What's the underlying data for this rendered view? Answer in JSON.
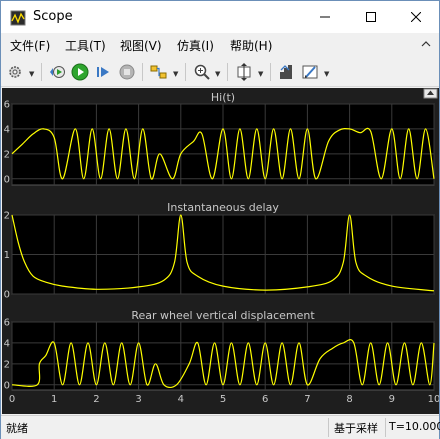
{
  "window": {
    "title": "Scope"
  },
  "menu": [
    "文件(F)",
    "工具(T)",
    "视图(V)",
    "仿真(I)",
    "帮助(H)"
  ],
  "toolbar": {
    "icons": [
      "gear-icon",
      "restore-settings-icon",
      "run-icon",
      "step-forward-icon",
      "stop-icon",
      "highlight-icon",
      "zoom-in-icon",
      "scale-axes-icon",
      "cursor-measure-icon",
      "style-icon"
    ]
  },
  "plots": [
    {
      "title": "Hi(t)",
      "yticks": [
        "0",
        "2",
        "4",
        "6"
      ]
    },
    {
      "title": "Instantaneous delay",
      "yticks": [
        "0",
        "1",
        "2"
      ]
    },
    {
      "title": "Rear wheel vertical displacement",
      "yticks": [
        "0",
        "2",
        "4",
        "6"
      ]
    }
  ],
  "xticks": [
    "0",
    "1",
    "2",
    "3",
    "4",
    "5",
    "6",
    "7",
    "8",
    "9",
    "10"
  ],
  "status": {
    "left": "就绪",
    "sample": "基于采样",
    "time": "T=10.000"
  },
  "colors": {
    "trace": "#ffff00",
    "axes_bg": "#000000",
    "figure_bg": "#1e1e1e",
    "grid": "#3a3a3a",
    "text": "#c8c8c8"
  },
  "chart_data": [
    {
      "type": "line",
      "title": "Hi(t)",
      "xlim": [
        0,
        10
      ],
      "ylim": [
        -0.5,
        6
      ],
      "grid": true,
      "x": [
        0,
        0.25,
        0.5,
        0.75,
        1.0,
        1.2,
        1.5,
        1.7,
        1.9,
        2.1,
        2.3,
        2.5,
        2.7,
        2.9,
        3.1,
        3.3,
        3.5,
        3.8,
        4.0,
        4.3,
        4.5,
        4.75,
        5.0,
        5.2,
        5.4,
        5.6,
        5.8,
        6.0,
        6.2,
        6.4,
        6.6,
        6.8,
        7.0,
        7.2,
        7.5,
        7.75,
        8.0,
        8.25,
        8.5,
        8.75,
        9.0,
        9.2,
        9.4,
        9.6,
        9.8,
        10.0
      ],
      "y": [
        2.0,
        2.8,
        3.6,
        4.0,
        3.3,
        0.0,
        4.0,
        0.0,
        4.0,
        0.0,
        4.0,
        0.0,
        4.0,
        0.0,
        4.0,
        0.0,
        2.0,
        0.0,
        2.0,
        3.0,
        3.6,
        0.0,
        4.0,
        0.0,
        4.0,
        0.0,
        4.0,
        0.0,
        4.0,
        0.0,
        4.0,
        0.0,
        4.0,
        0.0,
        3.0,
        3.9,
        4.0,
        3.7,
        3.8,
        0.0,
        4.0,
        0.0,
        4.0,
        0.0,
        4.0,
        0.0
      ]
    },
    {
      "type": "line",
      "title": "Instantaneous delay",
      "xlim": [
        0,
        10
      ],
      "ylim": [
        0,
        2
      ],
      "grid": true,
      "x": [
        0,
        0.15,
        0.3,
        0.5,
        0.8,
        1.2,
        2.0,
        3.0,
        3.6,
        3.85,
        4.0,
        4.15,
        4.4,
        5.0,
        6.0,
        7.0,
        7.6,
        7.85,
        8.0,
        8.15,
        8.4,
        9.0,
        10.0
      ],
      "y": [
        2.0,
        1.3,
        0.8,
        0.45,
        0.3,
        0.2,
        0.12,
        0.18,
        0.35,
        0.8,
        2.0,
        0.8,
        0.45,
        0.2,
        0.1,
        0.18,
        0.35,
        0.8,
        2.0,
        0.8,
        0.45,
        0.2,
        0.08
      ]
    },
    {
      "type": "line",
      "title": "Rear wheel vertical displacement",
      "xlim": [
        0,
        10
      ],
      "ylim": [
        -0.5,
        6
      ],
      "grid": true,
      "x": [
        0,
        0.6,
        0.65,
        0.8,
        1.0,
        1.2,
        1.4,
        1.6,
        1.8,
        2.0,
        2.2,
        2.4,
        2.6,
        2.8,
        3.0,
        3.2,
        3.4,
        3.6,
        3.9,
        4.2,
        4.4,
        4.6,
        4.8,
        5.0,
        5.2,
        5.4,
        5.6,
        5.8,
        6.0,
        6.2,
        6.4,
        6.6,
        6.8,
        7.0,
        7.3,
        7.6,
        7.85,
        8.1,
        8.3,
        8.5,
        8.7,
        8.9,
        9.1,
        9.3,
        9.5,
        9.7,
        9.9,
        10.0
      ],
      "y": [
        0.0,
        0.0,
        2.0,
        2.8,
        4.0,
        0.0,
        4.0,
        0.0,
        4.0,
        0.0,
        4.0,
        0.0,
        4.0,
        0.0,
        4.0,
        0.0,
        2.0,
        0.0,
        0.0,
        2.0,
        4.0,
        0.0,
        4.0,
        0.0,
        4.0,
        0.0,
        4.0,
        0.0,
        4.0,
        0.0,
        4.0,
        0.0,
        4.0,
        0.0,
        2.5,
        3.5,
        4.0,
        4.0,
        0.0,
        4.0,
        0.0,
        4.0,
        0.0,
        4.0,
        0.0,
        4.0,
        0.0,
        4.0
      ]
    }
  ]
}
